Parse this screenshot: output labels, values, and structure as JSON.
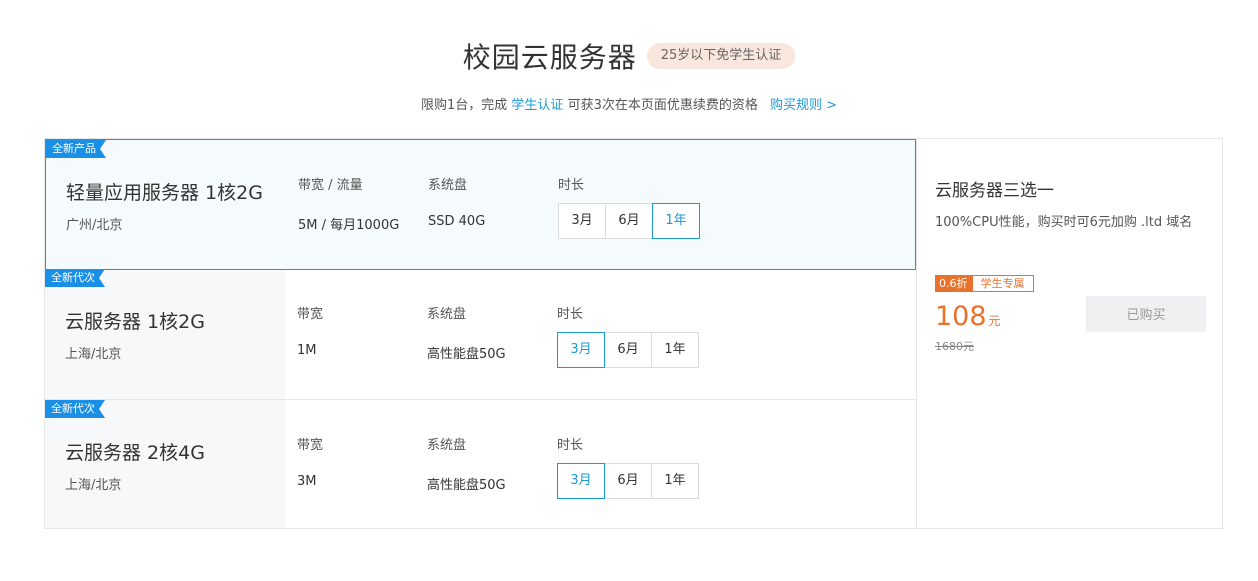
{
  "header": {
    "title": "校园云服务器",
    "badge": "25岁以下免学生认证",
    "sub_prefix": "限购1台，完成",
    "sub_link": "学生认证",
    "sub_mid": "可获3次在本页面优惠续费的资格",
    "rules_link": "购买规则 >"
  },
  "products": [
    {
      "tag": "全新产品",
      "name": "轻量应用服务器 1核2G",
      "region": "广州/北京",
      "bandwidth_label": "带宽 / 流量",
      "bandwidth_value": "5M / 每月1000G",
      "disk_label": "系统盘",
      "disk_value": "SSD 40G",
      "duration_label": "时长",
      "durations": [
        "3月",
        "6月",
        "1年"
      ],
      "selected_duration": "1年",
      "active": true
    },
    {
      "tag": "全新代次",
      "name": "云服务器 1核2G",
      "region": "上海/北京",
      "bandwidth_label": "带宽",
      "bandwidth_value": "1M",
      "disk_label": "系统盘",
      "disk_value": "高性能盘50G",
      "duration_label": "时长",
      "durations": [
        "3月",
        "6月",
        "1年"
      ],
      "selected_duration": "3月",
      "active": false
    },
    {
      "tag": "全新代次",
      "name": "云服务器 2核4G",
      "region": "上海/北京",
      "bandwidth_label": "带宽",
      "bandwidth_value": "3M",
      "disk_label": "系统盘",
      "disk_value": "高性能盘50G",
      "duration_label": "时长",
      "durations": [
        "3月",
        "6月",
        "1年"
      ],
      "selected_duration": "3月",
      "active": false
    }
  ],
  "summary": {
    "title": "云服务器三选一",
    "desc": "100%CPU性能，购买时可6元加购 .ltd 域名",
    "discount_badge": "0.6折",
    "student_badge": "学生专属",
    "price": "108",
    "price_unit": "元",
    "original_price": "1680元",
    "buy_label": "已购买"
  },
  "colors": {
    "accent": "#1a9bd6",
    "tag_blue": "#1a8fe6",
    "orange": "#e8722c",
    "badge_bg": "#f9e6dc"
  }
}
